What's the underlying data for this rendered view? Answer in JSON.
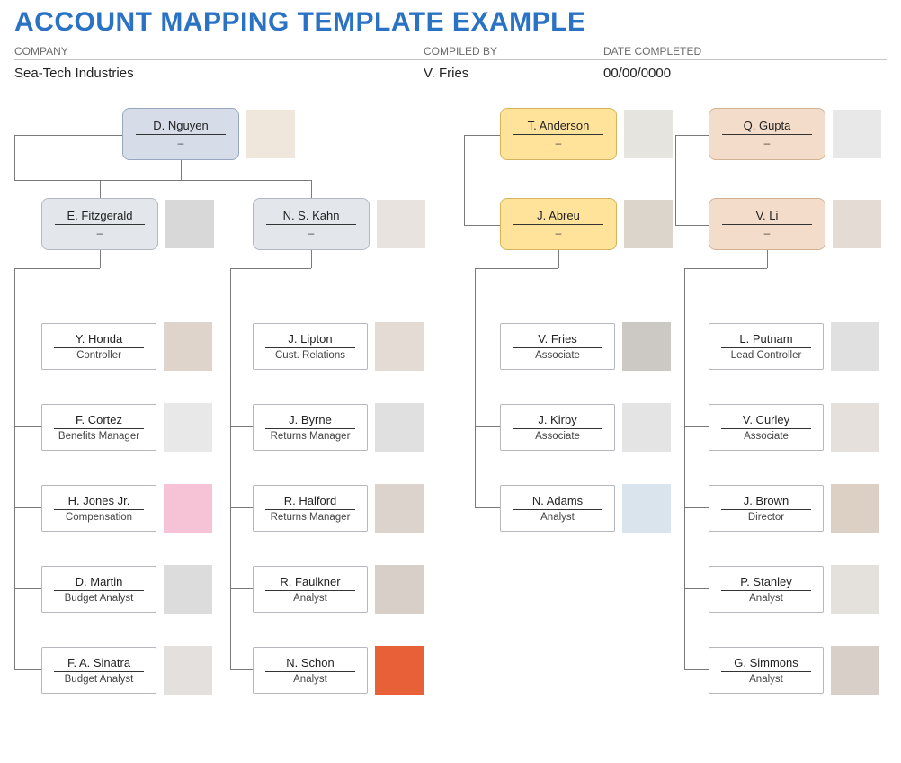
{
  "title": "ACCOUNT MAPPING TEMPLATE EXAMPLE",
  "labels": {
    "company": "COMPANY",
    "compiled_by": "COMPILED BY",
    "date_completed": "DATE COMPLETED"
  },
  "values": {
    "company": "Sea-Tech Industries",
    "compiled_by": "V. Fries",
    "date_completed": "00/00/0000"
  },
  "dash": "–",
  "nodes": {
    "a1": {
      "name": "D. Nguyen"
    },
    "b1": {
      "name": "E. Fitzgerald"
    },
    "b2": {
      "name": "N. S. Kahn"
    },
    "c1": {
      "name": "T. Anderson"
    },
    "c2": {
      "name": "J. Abreu"
    },
    "d1": {
      "name": "Q. Gupta"
    },
    "d2": {
      "name": "V. Li"
    },
    "l_b1_0": {
      "name": "Y. Honda",
      "role": "Controller"
    },
    "l_b1_1": {
      "name": "F. Cortez",
      "role": "Benefits Manager"
    },
    "l_b1_2": {
      "name": "H. Jones Jr.",
      "role": "Compensation"
    },
    "l_b1_3": {
      "name": "D. Martin",
      "role": "Budget Analyst"
    },
    "l_b1_4": {
      "name": "F. A. Sinatra",
      "role": "Budget Analyst"
    },
    "l_b2_0": {
      "name": "J. Lipton",
      "role": "Cust. Relations"
    },
    "l_b2_1": {
      "name": "J. Byrne",
      "role": "Returns Manager"
    },
    "l_b2_2": {
      "name": "R. Halford",
      "role": "Returns Manager"
    },
    "l_b2_3": {
      "name": "R. Faulkner",
      "role": "Analyst"
    },
    "l_b2_4": {
      "name": "N. Schon",
      "role": "Analyst"
    },
    "l_c2_0": {
      "name": "V. Fries",
      "role": "Associate"
    },
    "l_c2_1": {
      "name": "J. Kirby",
      "role": "Associate"
    },
    "l_c2_2": {
      "name": "N. Adams",
      "role": "Analyst"
    },
    "l_d2_0": {
      "name": "L. Putnam",
      "role": "Lead Controller"
    },
    "l_d2_1": {
      "name": "V. Curley",
      "role": "Associate"
    },
    "l_d2_2": {
      "name": "J. Brown",
      "role": "Director"
    },
    "l_d2_3": {
      "name": "P. Stanley",
      "role": "Analyst"
    },
    "l_d2_4": {
      "name": "G. Simmons",
      "role": "Analyst"
    }
  },
  "photo_colors": {
    "a1": "#efe7dc",
    "b1": "#d8d8d8",
    "b2": "#e9e3e0",
    "c1": "#e6e4de",
    "c2": "#dcd5cc",
    "d1": "#e8e8e8",
    "d2": "#e4dcd4",
    "l_b1_0": "#ded4cc",
    "l_b1_1": "#e8e8e8",
    "l_b1_2": "#f6c3d6",
    "l_b1_3": "#dcdcdc",
    "l_b1_4": "#e4e0de",
    "l_b2_0": "#e4dcd4",
    "l_b2_1": "#e0e0e0",
    "l_b2_2": "#dcd4cc",
    "l_b2_3": "#d8d0c8",
    "l_b2_4": "#e86038",
    "l_c2_0": "#ccc8c4",
    "l_c2_1": "#e4e4e4",
    "l_c2_2": "#d9e4ec",
    "l_d2_0": "#e0e0e0",
    "l_d2_1": "#e6e0dc",
    "l_d2_2": "#dcd0c4",
    "l_d2_3": "#e4e0dc",
    "l_d2_4": "#d8d0c8"
  }
}
